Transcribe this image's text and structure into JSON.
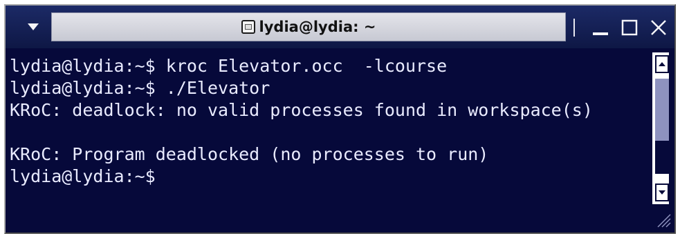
{
  "window": {
    "title": "lydia@lydia: ~",
    "menu_icon": "chevron-down-icon",
    "title_icon": "terminal-window-icon",
    "controls": [
      "minimize-icon",
      "maximize-icon",
      "close-icon"
    ]
  },
  "terminal": {
    "lines": [
      "lydia@lydia:~$ kroc Elevator.occ  -lcourse",
      "lydia@lydia:~$ ./Elevator",
      "KRoC: deadlock: no valid processes found in workspace(s)",
      "",
      "KRoC: Program deadlocked (no processes to run)",
      "lydia@lydia:~$"
    ]
  },
  "scrollbar": {
    "up_icon": "arrow-up-icon",
    "down_icon": "arrow-down-icon"
  },
  "colors": {
    "terminal_bg": "#06093a",
    "terminal_fg": "#e9ebff",
    "titlebar_bg": "#16204e",
    "scroll_thumb": "#8e92bf"
  }
}
